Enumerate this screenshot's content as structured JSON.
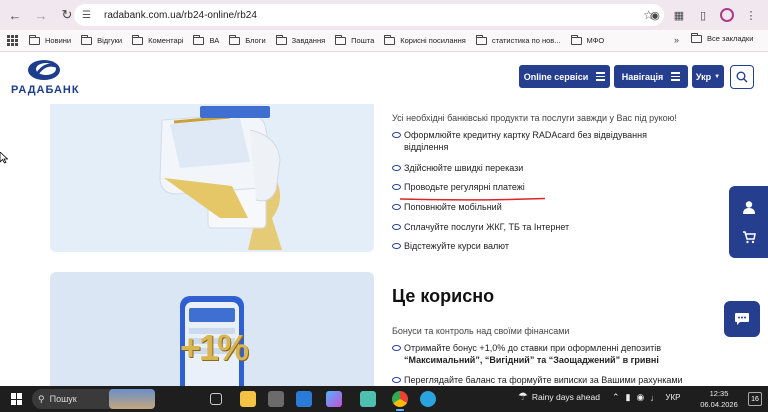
{
  "browser": {
    "url": "radabank.com.ua/rb24-online/rb24",
    "bookmarks": [
      "Новини",
      "Відгуки",
      "Коментарі",
      "ВА",
      "Блоги",
      "Завдання",
      "Пошта",
      "Корисні посилання",
      "статистика по нов...",
      "МФО"
    ],
    "all_bookmarks": "Все закладки"
  },
  "site": {
    "logo_text": "РАДАБАНК",
    "online_services": "Online сервіси",
    "navigation": "Навігація",
    "language": "Укр"
  },
  "section1": {
    "intro": "Усі необхідні банківські продукти та послуги завжди у Вас під рукою!",
    "items": [
      "Оформлюйте кредитну картку RADAcard без відвідування",
      "відділення",
      "Здійснюйте швидкі перекази",
      "Проводьте регулярні платежі",
      "Поповнюйте мобільний",
      "Сплачуйте послуги ЖКГ, ТБ та Інтернет",
      "Відстежуйте курси валют"
    ]
  },
  "section2": {
    "title": "Це корисно",
    "subtitle": "Бонуси та контроль над своїми фінансами",
    "item1_line1": "Отримайте бонус +1,0% до ставки при оформленні депозитів",
    "item1_line2": "“Максимальний”, “Вигідний” та “Заощаджений” в гривні",
    "item2": "Переглядайте баланс та формуйте виписки за Вашими рахунками",
    "promo": "+1%"
  },
  "taskbar": {
    "search": "Пошук",
    "weather": "Rainy days ahead",
    "lang": "УКР",
    "time": "12:35",
    "date": "06.04.2026",
    "notifications": "16"
  },
  "colors": {
    "brand": "#253e8e",
    "accent_underline": "#d8252c"
  }
}
